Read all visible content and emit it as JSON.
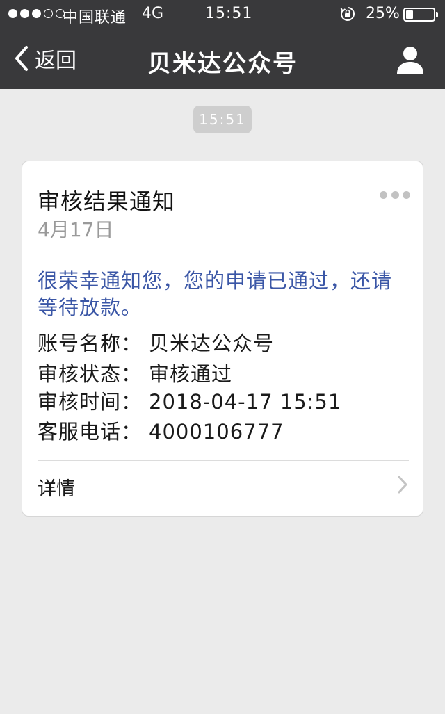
{
  "status_bar": {
    "carrier": "中国联通",
    "network": "4G",
    "time": "15:51",
    "battery_percent_text": "25%",
    "battery_level": 0.25,
    "signal_bars_on": 3,
    "signal_bars_total": 5
  },
  "nav": {
    "back_label": "返回",
    "title": "贝米达公众号",
    "back_icon": "chevron-left-icon",
    "profile_icon": "person-icon"
  },
  "chat": {
    "timestamp": "15:51"
  },
  "card": {
    "title": "审核结果通知",
    "date": "4月17日",
    "intro": "很荣幸通知您，您的申请已通过，还请等待放款。",
    "fields": [
      {
        "label": "账号名称：",
        "value": "贝米达公众号"
      },
      {
        "label": "审核状态：",
        "value": "审核通过"
      },
      {
        "label": "审核时间：",
        "value": "2018-04-17 15:51"
      },
      {
        "label": "客服电话：",
        "value": "4000106777"
      }
    ],
    "detail_label": "详情",
    "more_icon": "more-dots-icon",
    "detail_icon": "chevron-right-icon"
  },
  "colors": {
    "header_bg": "#39393b",
    "page_bg": "#ebebeb",
    "intro_text": "#3a56a6",
    "muted_text": "#9a9a9a"
  }
}
